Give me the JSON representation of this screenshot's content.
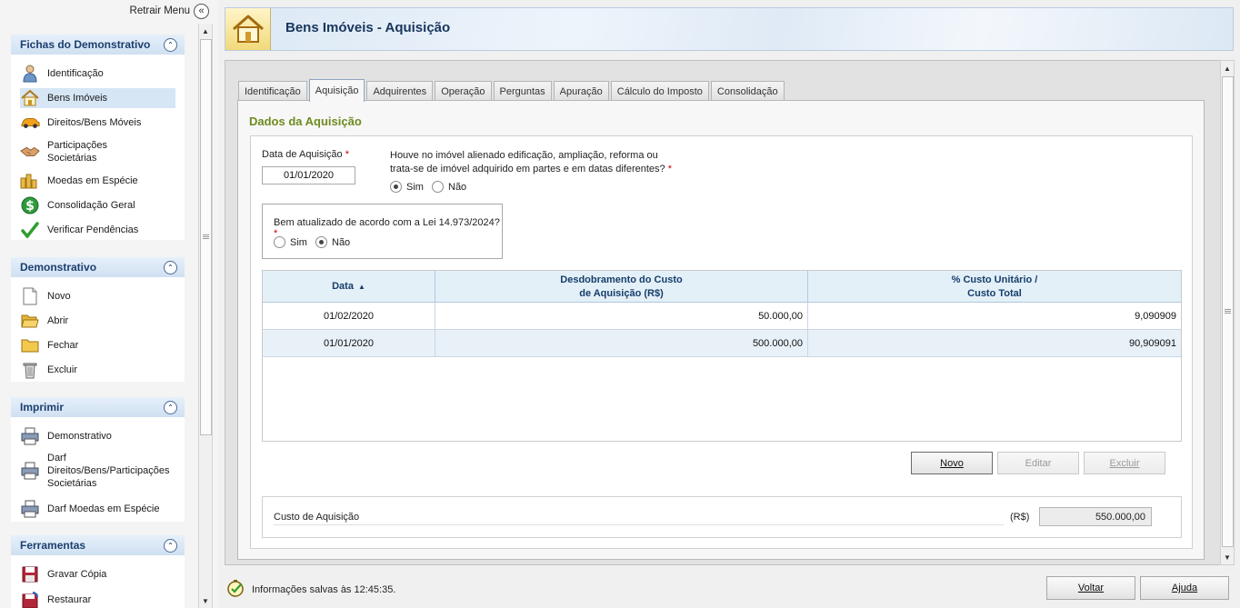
{
  "sidebar": {
    "retrair_label": "Retrair Menu",
    "sections": [
      {
        "title": "Fichas do Demonstrativo",
        "items": [
          "Identificação",
          "Bens Imóveis",
          "Direitos/Bens Móveis",
          "Participações Societárias",
          "Moedas em Espécie",
          "Consolidação Geral",
          "Verificar Pendências"
        ]
      },
      {
        "title": "Demonstrativo",
        "items": [
          "Novo",
          "Abrir",
          "Fechar",
          "Excluir"
        ]
      },
      {
        "title": "Imprimir",
        "items": [
          "Demonstrativo",
          "Darf Direitos/Bens/Participações Societárias",
          "Darf Moedas em Espécie"
        ]
      },
      {
        "title": "Ferramentas",
        "items": [
          "Gravar Cópia",
          "Restaurar"
        ]
      }
    ],
    "active_item": "Bens Imóveis"
  },
  "header": {
    "title": "Bens Imóveis - Aquisição"
  },
  "tabs": [
    "Identificação",
    "Aquisição",
    "Adquirentes",
    "Operação",
    "Perguntas",
    "Apuração",
    "Cálculo do Imposto",
    "Consolidação"
  ],
  "active_tab": "Aquisição",
  "form": {
    "section_title": "Dados da Aquisição",
    "data_aquisicao_label": "Data de Aquisição",
    "data_aquisicao_value": "01/01/2020",
    "required_mark": "*",
    "edificacao_question_line1": "Houve no imóvel alienado edificação, ampliação, reforma ou",
    "edificacao_question_line2": "trata-se de imóvel adquirido em partes e em datas diferentes?",
    "edificacao_selected": "Sim",
    "lei_question": "Bem atualizado de acordo com a Lei 14.973/2024?",
    "lei_selected": "Não",
    "option_sim": "Sim",
    "option_nao": "Não"
  },
  "table": {
    "headers": [
      {
        "line1": "Data",
        "line2": "",
        "sort": "asc"
      },
      {
        "line1": "Desdobramento do Custo",
        "line2": "de Aquisição (R$)"
      },
      {
        "line1": "% Custo Unitário /",
        "line2": "Custo Total"
      }
    ],
    "rows": [
      {
        "data": "01/02/2020",
        "custo": "50.000,00",
        "percentual": "9,090909"
      },
      {
        "data": "01/01/2020",
        "custo": "500.000,00",
        "percentual": "90,909091"
      }
    ],
    "selected_row": 1
  },
  "buttons": {
    "novo": "Novo",
    "editar": "Editar",
    "excluir": "Excluir",
    "voltar": "Voltar",
    "ajuda": "Ajuda"
  },
  "custo": {
    "label": "Custo de Aquisição",
    "currency": "(R$)",
    "value": "550.000,00"
  },
  "status": {
    "message": "Informações salvas às 12:45:35."
  },
  "colors": {
    "accent_blue": "#1d3f6e",
    "section_green": "#6f8b1f",
    "required_red": "#d10000"
  }
}
